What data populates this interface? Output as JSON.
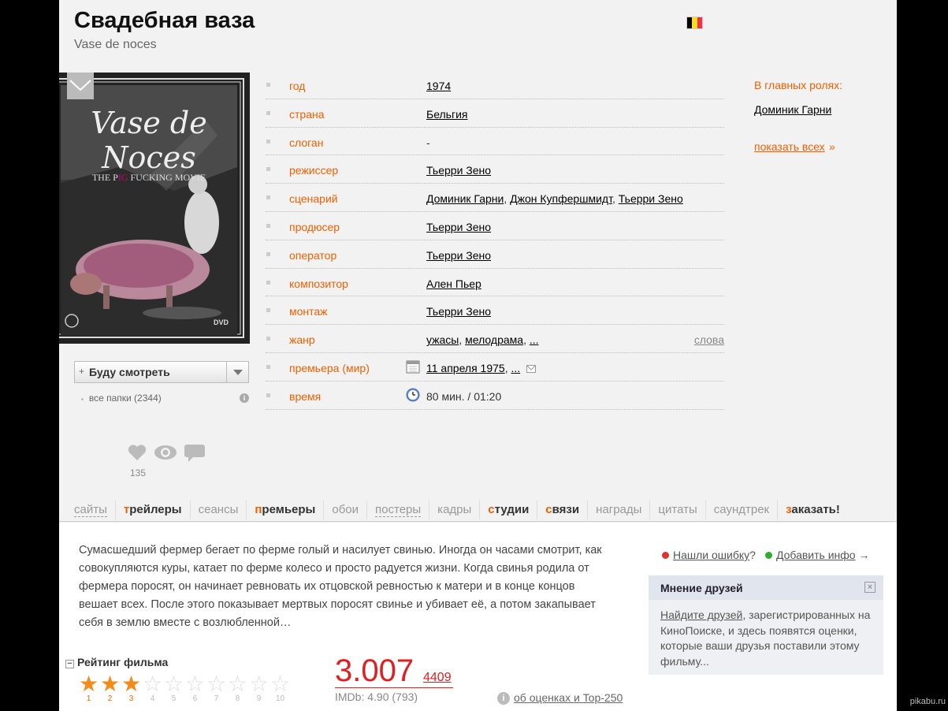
{
  "film": {
    "title": "Свадебная ваза",
    "original_title": "Vase de noces",
    "flag_colors": [
      "#000000",
      "#fdda24",
      "#ef3340"
    ]
  },
  "poster": {
    "title_line1": "Vase de Noces",
    "tagline_a": "THE P",
    "tagline_b": "IG",
    "tagline_c": " FUCKING MOVIE",
    "dvd": "DVD"
  },
  "watchlist": {
    "plus": "+",
    "button_label": "Буду смотреть",
    "folders_text": "все папки (2344)",
    "info_glyph": "i"
  },
  "social": {
    "likes_count": "135"
  },
  "info_rows": [
    {
      "key": "год",
      "value": "1974"
    },
    {
      "key": "страна",
      "value": "Бельгия"
    },
    {
      "key": "слоган",
      "value": "-"
    },
    {
      "key": "режиссер",
      "value": "Тьерри Зено"
    },
    {
      "key": "сценарий",
      "values": [
        "Доминик Гарни",
        "Джон Купфершмидт",
        "Тьерри Зено"
      ]
    },
    {
      "key": "продюсер",
      "value": "Тьерри Зено"
    },
    {
      "key": "оператор",
      "value": "Тьерри Зено"
    },
    {
      "key": "композитор",
      "value": "Ален Пьер"
    },
    {
      "key": "монтаж",
      "value": "Тьерри Зено"
    },
    {
      "key": "жанр",
      "values": [
        "ужасы",
        "мелодрама",
        "..."
      ],
      "extra": "слова"
    },
    {
      "key": "премьера (мир)",
      "values": [
        "11 апреля 1975",
        "..."
      ]
    },
    {
      "key": "время",
      "value": "80 мин. / 01:20"
    }
  ],
  "separators": {
    "comma": ", "
  },
  "cast": {
    "heading": "В главных ролях:",
    "actors": [
      "Доминик Гарни"
    ],
    "show_all": "показать всех",
    "show_all_arrow": "»"
  },
  "tabs": [
    {
      "label": "сайты"
    },
    {
      "first": "т",
      "rest": "рейлеры"
    },
    {
      "label": "сеансы"
    },
    {
      "first": "п",
      "rest": "ремьеры"
    },
    {
      "label": "обои"
    },
    {
      "label": "постеры"
    },
    {
      "label": "кадры"
    },
    {
      "first": "с",
      "rest": "тудии"
    },
    {
      "first": "с",
      "rest": "вязи"
    },
    {
      "label": "награды"
    },
    {
      "label": "цитаты"
    },
    {
      "label": "саундтрек"
    },
    {
      "first": "з",
      "rest": "аказать!"
    }
  ],
  "description": "Сумасшедший фермер бегает по ферме голый и насилует свинью. Иногда он часами смотрит, как совокупляются куры, катает по ферме колесо и просто радуется жизни. Когда свинья родила от фермера поросят, он начинает ревновать их отцовской ревностью к матери и в конце концов вешает всех. После этого показывает мертвых поросят свинье и убивает её, а потом закапывает себя в землю вместе с возлюбленной…",
  "report": {
    "error_link": "Нашли ошибку",
    "question": "?",
    "add_info_link": "Добавить инфо",
    "arrow": "→"
  },
  "friends_box": {
    "title": "Мнение друзей",
    "close": "×",
    "link": "Найдите друзей",
    "text": ", зарегистрированных на КиноПоиске, и здесь появятся оценки, которые ваши друзья поставили этому фильму..."
  },
  "rating": {
    "heading": "Рейтинг фильма",
    "minus": "−",
    "stars_total": 10,
    "stars_filled": 3,
    "star_numbers": [
      "1",
      "2",
      "3",
      "4",
      "5",
      "6",
      "7",
      "8",
      "9",
      "10"
    ],
    "score": "3.007",
    "votes": "4409",
    "imdb": "IMDb: 4.90 (793)",
    "about_link": "об оценках и Top-250",
    "about_glyph": "i"
  },
  "watermark": "pikabu.ru"
}
